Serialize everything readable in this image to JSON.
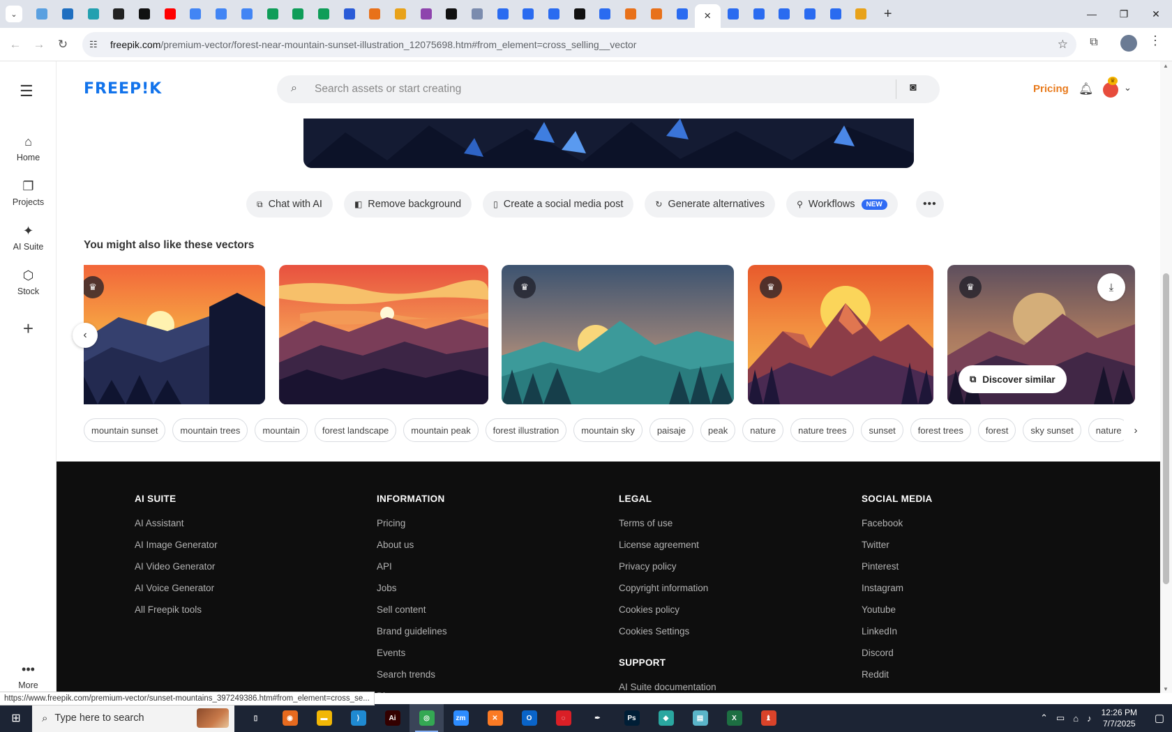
{
  "browser": {
    "tab_favicons": [
      {
        "icon": "freepik-icon",
        "color": "#5aa0e0"
      },
      {
        "icon": "vpn-icon",
        "color": "#1f6fc0"
      },
      {
        "icon": "teal-app-icon",
        "color": "#23a0b0"
      },
      {
        "icon": "openai-icon",
        "color": "#222222"
      },
      {
        "icon": "bolt-icon",
        "color": "#111111"
      },
      {
        "icon": "youtube-icon",
        "color": "#ff0000"
      },
      {
        "icon": "docs-icon",
        "color": "#4285f4"
      },
      {
        "icon": "docs-icon",
        "color": "#4285f4"
      },
      {
        "icon": "docs-icon",
        "color": "#4285f4"
      },
      {
        "icon": "sheets-icon",
        "color": "#0f9d58"
      },
      {
        "icon": "sheets-icon",
        "color": "#0f9d58"
      },
      {
        "icon": "sheets-icon",
        "color": "#0f9d58"
      },
      {
        "icon": "mj-icon",
        "color": "#2a5bd7"
      },
      {
        "icon": "orange-box-icon",
        "color": "#e8711a"
      },
      {
        "icon": "crown-icon",
        "color": "#e8a21a"
      },
      {
        "icon": "code-icon",
        "color": "#8e44ad"
      },
      {
        "icon": "adobe-icon",
        "color": "#111111"
      },
      {
        "icon": "grid-icon",
        "color": "#7b8cae"
      },
      {
        "icon": "flag-icon",
        "color": "#2a6bf0"
      },
      {
        "icon": "flag-icon",
        "color": "#2a6bf0"
      },
      {
        "icon": "flag-icon",
        "color": "#2a6bf0"
      },
      {
        "icon": "m-icon",
        "color": "#111111"
      },
      {
        "icon": "flag-icon",
        "color": "#2a6bf0"
      },
      {
        "icon": "orange-box-icon",
        "color": "#e8711a"
      },
      {
        "icon": "orange-box-icon",
        "color": "#e8711a"
      },
      {
        "icon": "flag-icon",
        "color": "#2a6bf0"
      },
      {
        "icon": "active-tab-close-icon",
        "color": "#ffffff",
        "active": true
      },
      {
        "icon": "flag-icon",
        "color": "#2a6bf0"
      },
      {
        "icon": "flag-icon",
        "color": "#2a6bf0"
      },
      {
        "icon": "flag-icon",
        "color": "#2a6bf0"
      },
      {
        "icon": "flag-icon",
        "color": "#2a6bf0"
      },
      {
        "icon": "flag-icon",
        "color": "#2a6bf0"
      },
      {
        "icon": "hand-icon",
        "color": "#e8a21a"
      }
    ],
    "url_domain": "freepik.com",
    "url_path": "/premium-vector/forest-near-mountain-sunset-illustration_12075698.htm#from_element=cross_selling__vector",
    "status_url": "https://www.freepik.com/premium-vector/sunset-mountains_397249386.htm#from_element=cross_se..."
  },
  "rail": {
    "items": [
      {
        "label": "Home",
        "icon": "home-icon"
      },
      {
        "label": "Projects",
        "icon": "projects-icon"
      },
      {
        "label": "AI Suite",
        "icon": "ai-suite-icon"
      },
      {
        "label": "Stock",
        "icon": "stock-icon"
      }
    ],
    "more_label": "More"
  },
  "header": {
    "logo": "FREEP!K",
    "search_placeholder": "Search assets or start creating",
    "pricing": "Pricing"
  },
  "actions": [
    {
      "label": "Chat with AI",
      "icon": "chat-icon"
    },
    {
      "label": "Remove background",
      "icon": "remove-bg-icon"
    },
    {
      "label": "Create a social media post",
      "icon": "phone-icon"
    },
    {
      "label": "Generate alternatives",
      "icon": "refresh-icon"
    },
    {
      "label": "Workflows",
      "icon": "workflow-icon",
      "badge": "NEW"
    }
  ],
  "related": {
    "title": "You might also like these vectors",
    "discover_label": "Discover similar"
  },
  "tags": [
    "mountain sunset",
    "mountain trees",
    "mountain",
    "forest landscape",
    "mountain peak",
    "forest illustration",
    "mountain sky",
    "paisaje",
    "peak",
    "nature",
    "nature trees",
    "sunset",
    "forest trees",
    "forest",
    "sky sunset",
    "nature"
  ],
  "footer": {
    "columns": [
      {
        "title": "AI SUITE",
        "links": [
          "AI Assistant",
          "AI Image Generator",
          "AI Video Generator",
          "AI Voice Generator",
          "All Freepik tools"
        ]
      },
      {
        "title": "INFORMATION",
        "links": [
          "Pricing",
          "About us",
          "API",
          "Jobs",
          "Sell content",
          "Brand guidelines",
          "Events",
          "Search trends",
          "Blog"
        ]
      },
      {
        "title": "LEGAL",
        "links": [
          "Terms of use",
          "License agreement",
          "Privacy policy",
          "Copyright information",
          "Cookies policy",
          "Cookies Settings"
        ],
        "sub_title": "SUPPORT",
        "sub_links": [
          "AI Suite documentation"
        ]
      },
      {
        "title": "SOCIAL MEDIA",
        "links": [
          "Facebook",
          "Twitter",
          "Pinterest",
          "Instagram",
          "Youtube",
          "LinkedIn",
          "Discord",
          "Reddit"
        ]
      }
    ]
  },
  "taskbar": {
    "search_placeholder": "Type here to search",
    "apps": [
      {
        "icon": "task-view-icon",
        "color": "#1c2434",
        "glyph": "▯"
      },
      {
        "icon": "firefox-icon",
        "color": "#e66a1f",
        "glyph": "◉"
      },
      {
        "icon": "file-explorer-icon",
        "color": "#f2b705",
        "glyph": "▬"
      },
      {
        "icon": "vscode-icon",
        "color": "#1f8ad2",
        "glyph": "⟩"
      },
      {
        "icon": "illustrator-icon",
        "color": "#330000",
        "glyph": "Ai"
      },
      {
        "icon": "chrome-icon",
        "color": "#34a853",
        "glyph": "◎",
        "active": true
      },
      {
        "icon": "zoom-icon",
        "color": "#2d8cff",
        "glyph": "zm"
      },
      {
        "icon": "xampp-icon",
        "color": "#fb7a24",
        "glyph": "✕"
      },
      {
        "icon": "outlook-icon",
        "color": "#0a64c8",
        "glyph": "O"
      },
      {
        "icon": "creative-cloud-icon",
        "color": "#da1f26",
        "glyph": "◌"
      },
      {
        "icon": "pen-tool-icon",
        "color": "#1c2434",
        "glyph": "✒"
      },
      {
        "icon": "photoshop-icon",
        "color": "#001e36",
        "glyph": "Ps"
      },
      {
        "icon": "diamond-app-icon",
        "color": "#2aa7a0",
        "glyph": "◆"
      },
      {
        "icon": "notepad-icon",
        "color": "#5ab4c8",
        "glyph": "▤"
      },
      {
        "icon": "excel-icon",
        "color": "#1d6f42",
        "glyph": "X"
      },
      {
        "icon": "figure-app-icon",
        "color": "#d9432a",
        "glyph": "♝"
      }
    ],
    "time": "12:26 PM",
    "date": "7/7/2025"
  }
}
